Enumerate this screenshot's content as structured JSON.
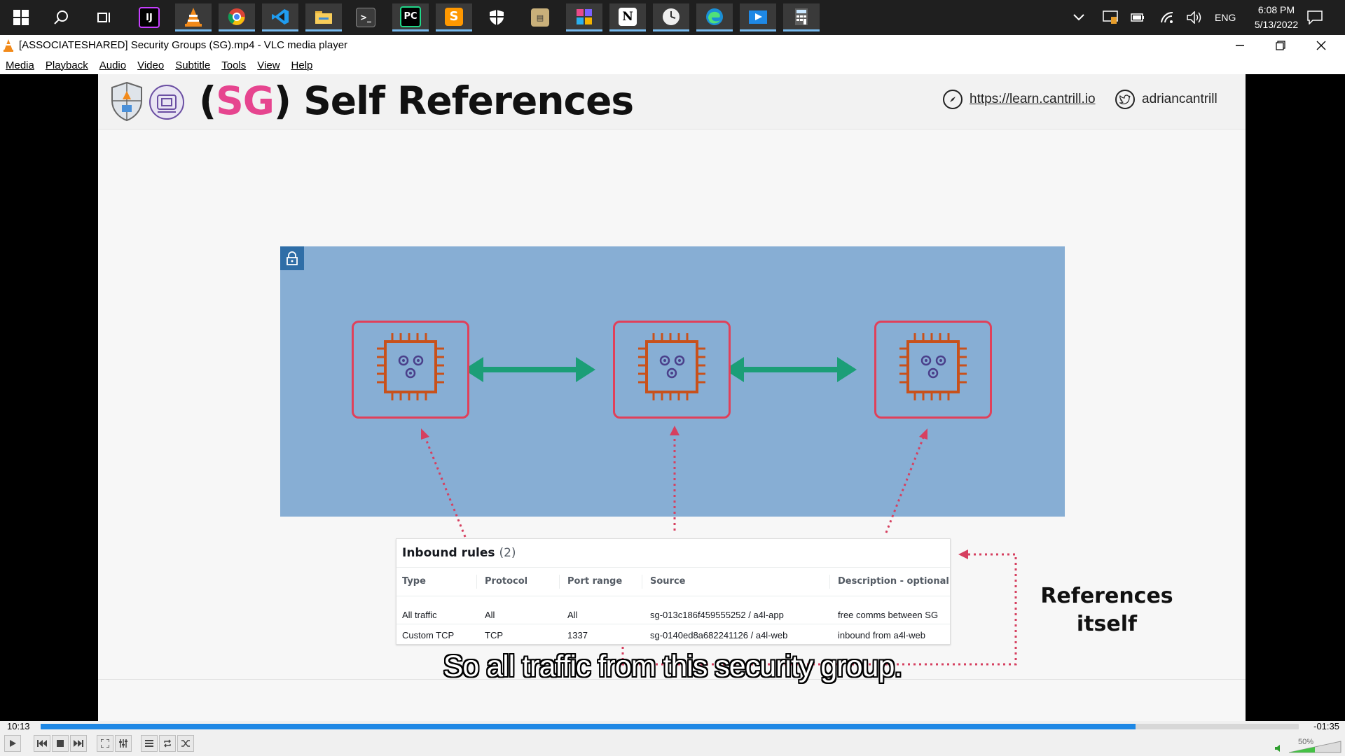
{
  "taskbar": {
    "icons": [
      "windows-start-icon",
      "search-icon",
      "task-view-icon",
      "intellij-icon",
      "vlc-icon",
      "chrome-icon",
      "vscode-icon",
      "file-explorer-icon",
      "terminal-icon",
      "pycharm-icon",
      "sublime-icon",
      "security-shield-icon",
      "scanner-icon",
      "app-grid-icon",
      "notion-icon",
      "clock-app-icon",
      "edge-icon",
      "media-player-icon",
      "calculator-icon"
    ],
    "tray": {
      "language": "ENG",
      "time": "6:08 PM",
      "date": "5/13/2022"
    }
  },
  "window": {
    "title": "[ASSOCIATESHARED] Security Groups (SG).mp4 - VLC media player",
    "menu": [
      "Media",
      "Playback",
      "Audio",
      "Video",
      "Subtitle",
      "Tools",
      "View",
      "Help"
    ]
  },
  "slide": {
    "title_prefix": "(",
    "title_highlight": "SG",
    "title_rest": ") Self References",
    "link": "https://learn.cantrill.io",
    "twitter": "adriancantrill",
    "inbound": {
      "title": "Inbound rules",
      "count": "(2)",
      "columns": [
        "Type",
        "Protocol",
        "Port range",
        "Source",
        "Description - optional"
      ],
      "rows": [
        [
          "All traffic",
          "All",
          "All",
          "sg-013c186f459555252 / a4l-app",
          "free comms between SG"
        ],
        [
          "Custom TCP",
          "TCP",
          "1337",
          "sg-0140ed8a682241126 / a4l-web",
          "inbound from a4l-web"
        ]
      ]
    },
    "references_label_line1": "References",
    "references_label_line2": "itself",
    "colors": {
      "accent_pink": "#e6458f",
      "vpc_blue": "#87aed4",
      "arrow_green": "#1b9e77",
      "instance_red": "#e0405a",
      "chip_orange": "#c8511b"
    }
  },
  "subtitle": "So all traffic from this security group.",
  "player": {
    "elapsed": "10:13",
    "remaining": "-01:35",
    "progress_percent": 87,
    "volume": "50%",
    "volume_percent": 50
  }
}
